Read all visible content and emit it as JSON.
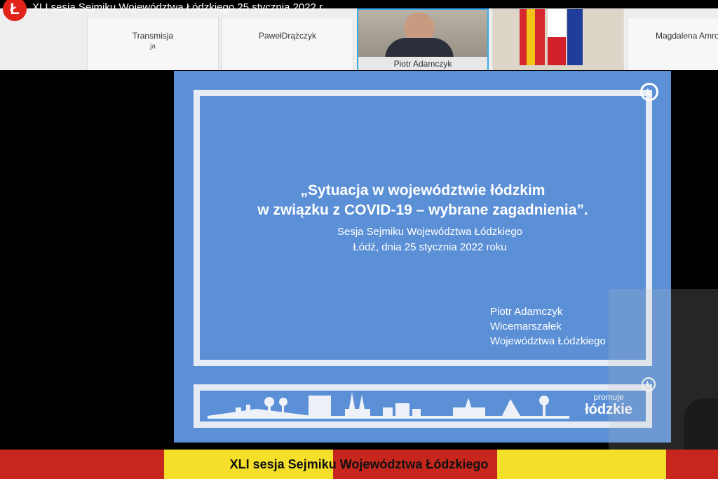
{
  "video": {
    "title": "XLI sesja Sejmiku Województwa Łódzkiego 25 stycznia 2022 r.",
    "logo_glyph": "Ł"
  },
  "participants": [
    {
      "name": "Transmisja",
      "sub": "ja"
    },
    {
      "name": "PawełDrążczyk"
    },
    {
      "name": "Piotr Adamczyk"
    },
    {
      "name": ""
    },
    {
      "name": "Magdalena Amro"
    }
  ],
  "slide": {
    "heading_line1": "„Sytuacja w województwie łódzkim",
    "heading_line2": "w związku z COVID-19 – wybrane zagadnienia”.",
    "sub_line1": "Sesja Sejmiku Województwa Łódzkiego",
    "sub_line2": "Łódź, dnia 25 stycznia 2022 roku",
    "author_name": "Piotr Adamczyk",
    "author_role1": "Wicemarszałek",
    "author_role2": "Województwa Łódzkiego",
    "promo_small": "promuje",
    "promo_big": "łódzkie",
    "corner_glyph": "Ł"
  },
  "ticker": {
    "text": "XLI sesja Sejmiku Województwa Łódzkiego"
  },
  "colors": {
    "slide_bg": "#5b8fd6",
    "frame": "#e7ecf4",
    "accent_red": "#e2231a",
    "ticker_yellow": "#f4df2b",
    "ticker_red": "#c7261d",
    "active_border": "#3aa9ee"
  }
}
